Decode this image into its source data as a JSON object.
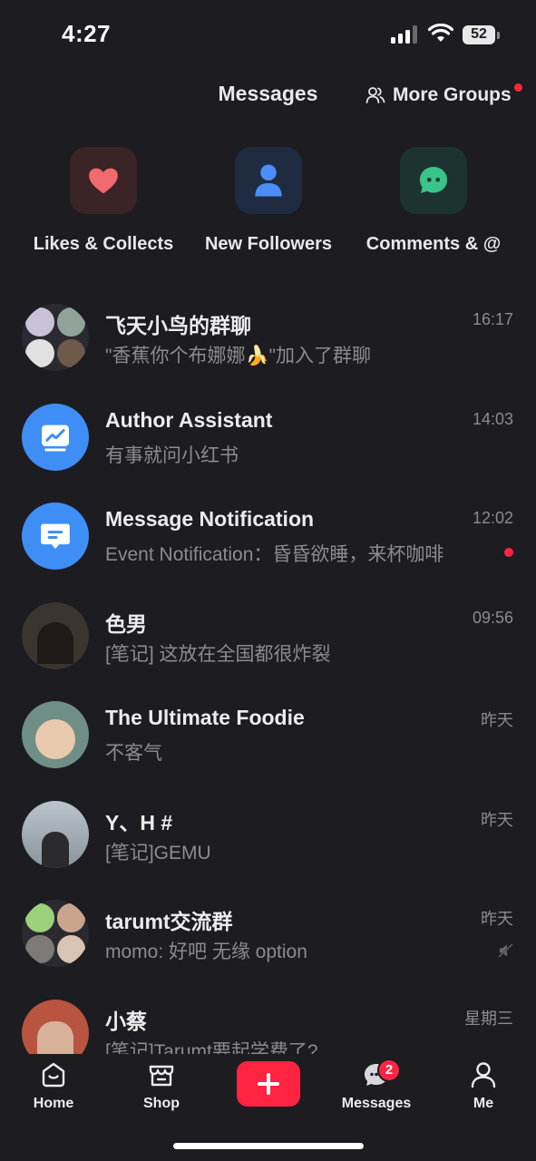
{
  "status_bar": {
    "time": "4:27",
    "battery": "52"
  },
  "header": {
    "title": "Messages",
    "more_groups_label": "More Groups"
  },
  "quick_actions": [
    {
      "label": "Likes & Collects",
      "icon": "heart-icon",
      "color": "#f06a6f"
    },
    {
      "label": "New Followers",
      "icon": "person-icon",
      "color": "#4c8ef7"
    },
    {
      "label": "Comments & @",
      "icon": "chat-bubble-icon",
      "color": "#38c48b"
    }
  ],
  "chats": [
    {
      "name": "飞天小鸟的群聊",
      "preview": "\"香蕉你个布娜娜🍌\"加入了群聊",
      "time": "16:17"
    },
    {
      "name": "Author Assistant",
      "preview": "有事就问小红书",
      "time": "14:03"
    },
    {
      "name": "Message Notification",
      "preview": "Event Notification：昏昏欲睡，来杯咖啡",
      "time": "12:02",
      "unread": true
    },
    {
      "name": "色男",
      "preview": "[笔记] 这放在全国都很炸裂",
      "time": "09:56"
    },
    {
      "name": "The Ultimate Foodie",
      "preview": "不客气",
      "time": "昨天"
    },
    {
      "name": "Y、H #",
      "preview": "[笔记]GEMU",
      "time": "昨天"
    },
    {
      "name": "tarumt交流群",
      "preview": "momo: 好吧 无缘 option",
      "time": "昨天",
      "muted": true
    },
    {
      "name": "小蔡",
      "preview": "[笔记]Tarumt要起学费了?",
      "time": "星期三"
    }
  ],
  "tab_bar": {
    "home": "Home",
    "shop": "Shop",
    "messages": "Messages",
    "messages_badge": "2",
    "me": "Me"
  },
  "colors": {
    "accent": "#ff2442",
    "background": "#1c1c21",
    "blue": "#3f8ef5"
  }
}
